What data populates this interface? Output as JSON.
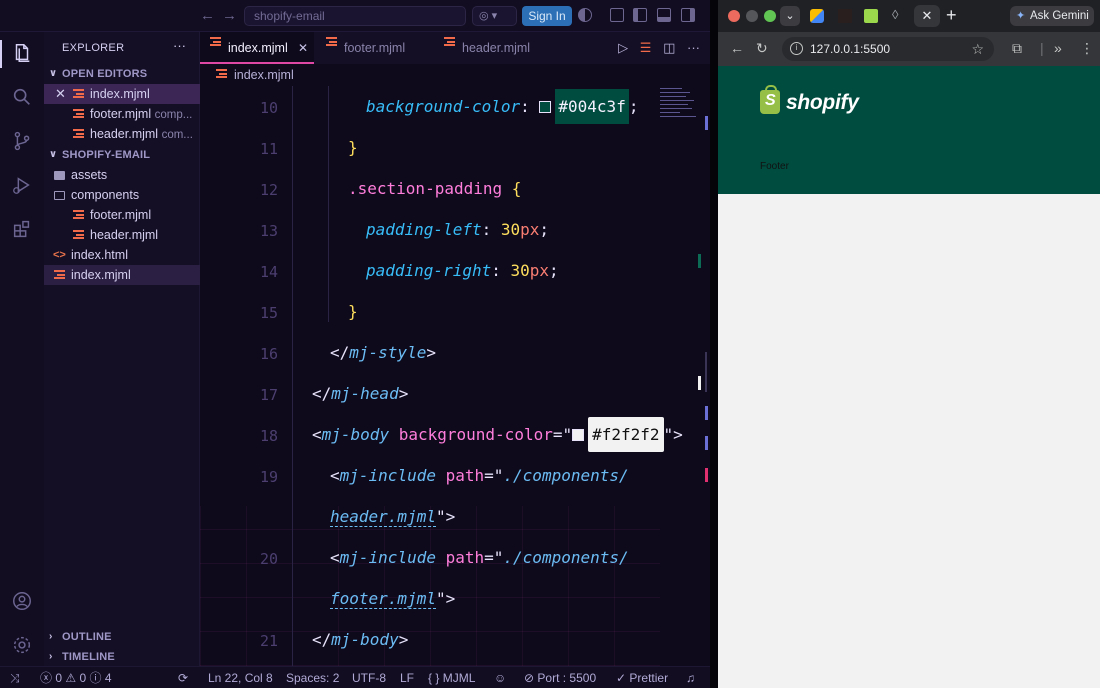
{
  "vscode": {
    "search_placeholder": "shopify-email",
    "sign_in": "Sign In",
    "explorer_title": "EXPLORER",
    "open_editors_label": "OPEN EDITORS",
    "open_editors": [
      {
        "name": "index.mjml",
        "desc": ""
      },
      {
        "name": "footer.mjml",
        "desc": "comp..."
      },
      {
        "name": "header.mjml",
        "desc": "com..."
      }
    ],
    "project_label": "SHOPIFY-EMAIL",
    "tree": {
      "assets": "assets",
      "components": "components",
      "footer": "footer.mjml",
      "header": "header.mjml",
      "index_html": "index.html",
      "index_mjml": "index.mjml"
    },
    "outline_label": "OUTLINE",
    "timeline_label": "TIMELINE",
    "tabs": [
      "index.mjml",
      "footer.mjml",
      "header.mjml"
    ],
    "breadcrumb": "index.mjml",
    "code": {
      "l10_prop": "background-color",
      "l10_val": "#004c3f",
      "l12_sel": ".section-padding",
      "l13_prop": "padding-left",
      "l13_num": "30",
      "l14_prop": "padding-right",
      "l14_num": "30",
      "unit": "px",
      "l16_tag": "mj-style",
      "l17_tag": "mj-head",
      "l18_tag": "mj-body",
      "l18_attr": "background-color",
      "l18_val": "#f2f2f2",
      "inc_tag": "mj-include",
      "inc_attr": "path",
      "l19_path_a": "./components/",
      "l19_path_b": "header.mjml",
      "l20_path_a": "./components/",
      "l20_path_b": "footer.mjml",
      "l21_tag": "mj-body"
    },
    "line_numbers": [
      "10",
      "11",
      "12",
      "13",
      "14",
      "15",
      "16",
      "17",
      "18",
      "19",
      "20",
      "21"
    ],
    "status": {
      "errors": "0",
      "warnings": "0",
      "info": "4",
      "position": "Ln 22, Col 8",
      "spaces": "Spaces: 2",
      "encoding": "UTF-8",
      "eol": "LF",
      "language": "MJML",
      "port": "Port : 5500",
      "formatter": "Prettier"
    }
  },
  "chrome": {
    "ask_gemini": "Ask Gemini",
    "url": "127.0.0.1:5500",
    "logo_text": "shopify",
    "footer_text": "Footer",
    "colors": {
      "header_bg": "#004c3f",
      "body_bg": "#f2f2f2"
    }
  }
}
